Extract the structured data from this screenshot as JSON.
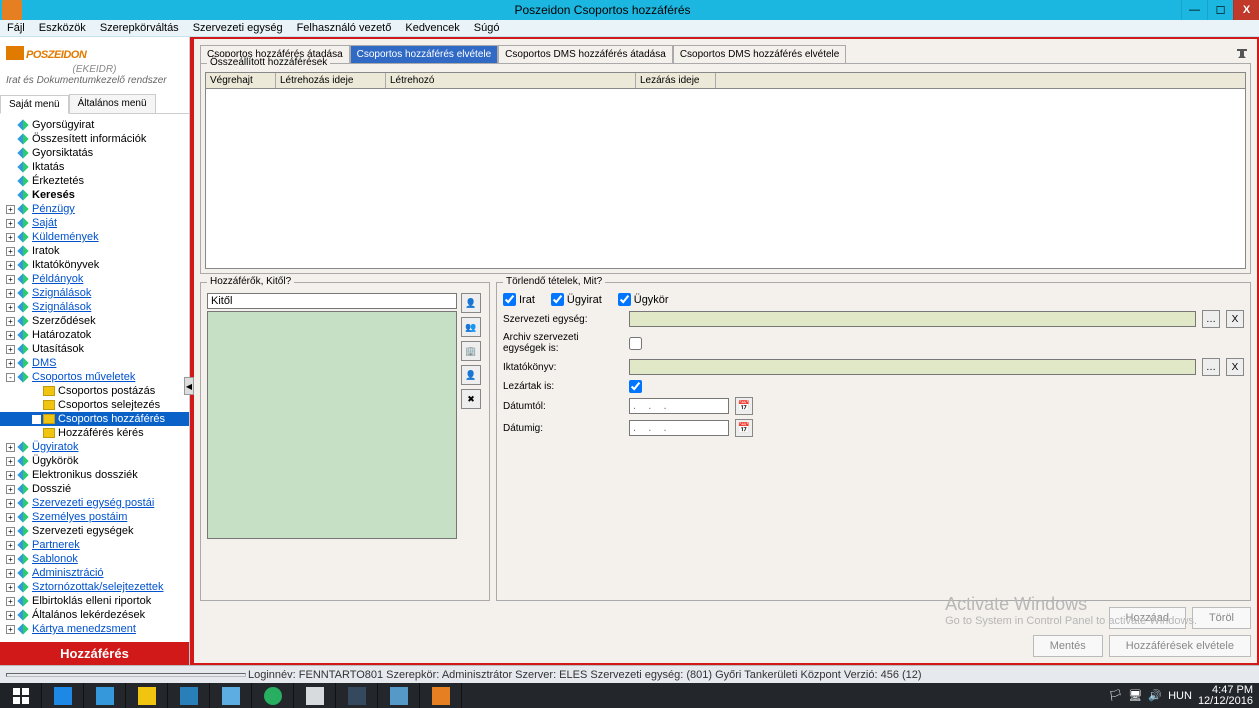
{
  "window": {
    "title": "Poszeidon Csoportos hozzáférés"
  },
  "menu": [
    "Fájl",
    "Eszközök",
    "Szerepkörváltás",
    "Szervezeti egység",
    "Felhasználó vezető",
    "Kedvencek",
    "Súgó"
  ],
  "logo": {
    "brand": "POSZEIDON",
    "sub1": "(EKEIDR)",
    "sub2": "Irat és Dokumentumkezelő rendszer"
  },
  "side_tabs": {
    "a": "Saját menü",
    "b": "Általános menü"
  },
  "tree": {
    "nodes": [
      {
        "label": "Gyorsügyirat"
      },
      {
        "label": "Összesített információk"
      },
      {
        "label": "Gyorsiktatás"
      },
      {
        "label": "Iktatás"
      },
      {
        "label": "Érkeztetés"
      },
      {
        "label": "Keresés",
        "bold": true
      },
      {
        "label": "Pénzügy",
        "link": true,
        "exp": "+"
      },
      {
        "label": "Saját",
        "link": true,
        "exp": "+"
      },
      {
        "label": "Küldemények",
        "link": true,
        "exp": "+"
      },
      {
        "label": "Iratok",
        "exp": "+"
      },
      {
        "label": "Iktatókönyvek",
        "exp": "+"
      },
      {
        "label": "Példányok",
        "link": true,
        "exp": "+"
      },
      {
        "label": "Szignálások",
        "link": true,
        "exp": "+"
      },
      {
        "label": "Szignálások",
        "link": true,
        "exp": "+"
      },
      {
        "label": "Szerződések",
        "exp": "+"
      },
      {
        "label": "Határozatok",
        "exp": "+"
      },
      {
        "label": "Utasítások",
        "exp": "+"
      },
      {
        "label": "DMS",
        "link": true,
        "exp": "+"
      },
      {
        "label": "Csoportos műveletek",
        "link": true,
        "exp": "-"
      },
      {
        "label": "Csoportos postázás",
        "child": true,
        "folder": true
      },
      {
        "label": "Csoportos selejtezés",
        "child": true,
        "folder": true
      },
      {
        "label": "Csoportos hozzáférés",
        "child": true,
        "folder": true,
        "selected": true
      },
      {
        "label": "Hozzáférés kérés",
        "child": true,
        "folder": true
      },
      {
        "label": "Ügyiratok",
        "link": true,
        "exp": "+"
      },
      {
        "label": "Ügykörök",
        "exp": "+"
      },
      {
        "label": "Elektronikus dossziék",
        "exp": "+"
      },
      {
        "label": "Dosszié",
        "exp": "+"
      },
      {
        "label": "Szervezeti egység postái",
        "link": true,
        "exp": "+"
      },
      {
        "label": "Személyes postáim",
        "link": true,
        "exp": "+"
      },
      {
        "label": "Szervezeti egységek",
        "exp": "+"
      },
      {
        "label": "Partnerek",
        "link": true,
        "exp": "+"
      },
      {
        "label": "Sablonok",
        "link": true,
        "exp": "+"
      },
      {
        "label": "Adminisztráció",
        "link": true,
        "exp": "+"
      },
      {
        "label": "Sztornózottak/selejtezettek",
        "link": true,
        "exp": "+"
      },
      {
        "label": "Elbirtoklás elleni riportok",
        "exp": "+"
      },
      {
        "label": "Általános lekérdezések",
        "exp": "+"
      },
      {
        "label": "Kártya menedzsment",
        "link": true,
        "exp": "+"
      }
    ]
  },
  "side_title": "Hozzáférés",
  "content_tabs": {
    "t1": "Csoportos hozzáférés átadása",
    "t2": "Csoportos hozzáférés elvétele",
    "t3": "Csoportos DMS hozzáférés átadása",
    "t4": "Csoportos DMS hozzáférés elvétele"
  },
  "group1_legend": "Összeállított hozzáférések",
  "grid_cols": {
    "c1": "Végrehajt",
    "c2": "Létrehozás ideje",
    "c3": "Létrehozó",
    "c4": "Lezárás ideje"
  },
  "panel_left_legend": "Hozzáférők, Kitől?",
  "panel_left_input": "Kitől",
  "panel_right_legend": "Törlendő tételek, Mit?",
  "checkboxes": {
    "irat": "Irat",
    "ugyirat": "Ügyirat",
    "ugykor": "Ügykör"
  },
  "form": {
    "szerv": "Szervezeti egység:",
    "archiv": "Archiv szervezeti egységek is:",
    "iktato": "Iktatókönyv:",
    "lezartak": "Lezártak is:",
    "datumtol": "Dátumtól:",
    "datumig": "Dátumig:",
    "date_ph": ".    .    ."
  },
  "x_btn": "X",
  "buttons": {
    "hozzaad": "Hozzáad",
    "torol": "Töröl",
    "mentes": "Mentés",
    "final": "Hozzáférések elvétele"
  },
  "watermark": {
    "l1": "Activate Windows",
    "l2": "Go to System in Control Panel to activate Windows."
  },
  "status": {
    "text": "Loginnév: FENNTARTO801   Szerepkör: Adminisztrátor   Szerver: ELES   Szervezeti egység: (801) Győri Tankerületi Központ   Verzió: 456 (12)"
  },
  "tray": {
    "lang": "HUN",
    "time": "4:47 PM",
    "date": "12/12/2016"
  }
}
